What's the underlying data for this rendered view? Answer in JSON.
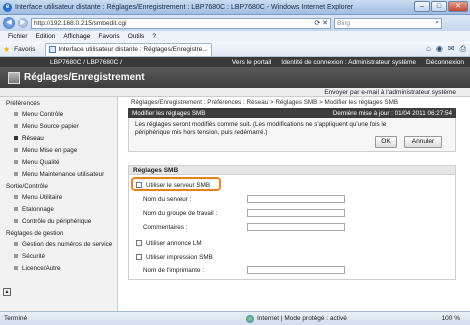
{
  "window": {
    "title": "Interface utilisateur distante : Réglages/Enregistrement : LBP7680C : LBP7680C - Windows Internet Explorer",
    "minimize": "–",
    "maximize": "□",
    "close": "✕"
  },
  "address": {
    "url": "http://192.168.0.215/smbedit.cgi",
    "search_placeholder": "Bing"
  },
  "menu": [
    "Fichier",
    "Edition",
    "Affichage",
    "Favoris",
    "Outils",
    "?"
  ],
  "favorites": {
    "label": "Favoris",
    "tab_title": "Interface utilisateur distante : Réglages/Enregistre..."
  },
  "printer_bar": {
    "model": "LBP7680C / LBP7680C /",
    "portal_link": "Vers le portail",
    "login_id": "Identité de connexion : Administrateur système",
    "logout": "Déconnexion"
  },
  "app": {
    "title": "Réglages/Enregistrement",
    "email_link": "Envoyer par e-mail à l'administrateur système"
  },
  "sidebar": {
    "sections": [
      {
        "title": "Préférences",
        "items": [
          "Menu Contrôle",
          "Menu Source papier",
          "Réseau",
          "Menu Mise en page",
          "Menu Qualité",
          "Menu Maintenance utilisateur"
        ]
      },
      {
        "title": "Sortie/Contrôle",
        "items": [
          "Menu Utilitaire",
          "Etalonnage",
          "Contrôle du périphérique"
        ]
      },
      {
        "title": "Réglages de gestion",
        "items": [
          "Gestion des numéros de service",
          "Sécurité",
          "Licence/Autre"
        ]
      }
    ],
    "active_item": "Réseau"
  },
  "breadcrumb": "Réglages/Enregistrement : Préférences : Réseau > Réglages SMB > Modifier les réglages SMB",
  "panel": {
    "title": "Modifier les réglages SMB",
    "last_update": "Dernière mise à jour : 01/04 2011 06:27:54",
    "message": "Les réglages seront modifiés comme suit. (Les modifications ne s'appliquent qu'une fois le périphérique mis hors tension, puis redémarré.)",
    "ok_label": "OK",
    "cancel_label": "Annuler"
  },
  "smb": {
    "section_title": "Réglages SMB",
    "use_server_label": "Utiliser le serveur SMB",
    "server_name_label": "Nom du serveur :",
    "workgroup_label": "Nom du groupe de travail :",
    "comments_label": "Commentaires :",
    "use_lm_label": "Utiliser annonce LM",
    "use_print_label": "Utiliser impression SMB",
    "printer_name_label": "Nom de l'imprimante :",
    "highlight_color": "#e8821c"
  },
  "status": {
    "text": "Terminé",
    "zone": "Internet | Mode protégé : activé",
    "zoom": "100 %"
  }
}
